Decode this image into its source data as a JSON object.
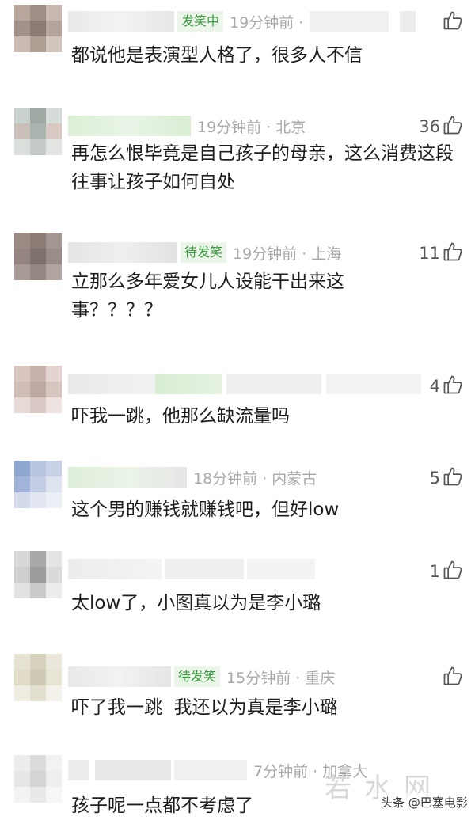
{
  "comments": [
    {
      "badge": "发笑中",
      "time": "19分钟前 ·",
      "likes": "",
      "text": "都说他是表演型人格了，很多人不信"
    },
    {
      "badge": "",
      "time": "19分钟前 · 北京",
      "likes": "36",
      "text": "再怎么恨毕竟是自己孩子的母亲，这么消费这段往事让孩子如何自处"
    },
    {
      "badge": "待发笑",
      "time": "19分钟前 · 上海",
      "likes": "11",
      "text": "立那么多年爱女儿人设能干出来这事？？？？"
    },
    {
      "badge": "",
      "time": "",
      "likes": "4",
      "text": "吓我一跳，他那么缺流量吗"
    },
    {
      "badge": "",
      "time": "18分钟前 · 内蒙古",
      "likes": "5",
      "text": "这个男的赚钱就赚钱吧，但好low"
    },
    {
      "badge": "",
      "time": "",
      "likes": "1",
      "text": "太low了，小图真以为是李小璐"
    },
    {
      "badge": "待发笑",
      "time": "15分钟前 · 重庆",
      "likes": "",
      "text": "吓了我一跳  我还以为真是李小璐"
    },
    {
      "badge": "",
      "time": "7分钟前 · 加拿大",
      "likes": "",
      "text": "孩子呢一点都不考虑了"
    }
  ],
  "watermark": {
    "site": "若水网",
    "source": "头条 @巴塞电影"
  },
  "icons": {
    "like": "thumbs-up-icon"
  }
}
